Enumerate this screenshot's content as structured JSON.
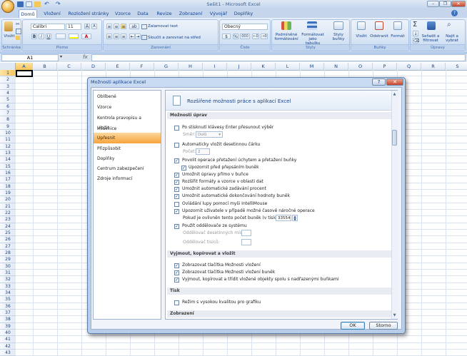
{
  "window": {
    "title": "Sešit1 - Microsoft Excel",
    "minimize": "–",
    "restore": "❐",
    "close": "✕"
  },
  "ribbon": {
    "tabs": [
      "Domů",
      "Vložení",
      "Rozložení stránky",
      "Vzorce",
      "Data",
      "Revize",
      "Zobrazení",
      "Vývojář",
      "Doplňky"
    ],
    "clipboard": {
      "paste": "Vložit",
      "label": "Schránka"
    },
    "font": {
      "name": "Calibri",
      "size": "11",
      "grow": "A",
      "shrink": "A",
      "bold": "B",
      "italic": "I",
      "underline": "U",
      "label": "Písmo"
    },
    "alignment": {
      "wrap": "Zalamovat text",
      "merge": "Sloučit a zarovnat na střed",
      "label": "Zarovnání"
    },
    "number": {
      "format": "Obecný",
      "currency": "%",
      "thousands": "000",
      "label": "Číslo"
    },
    "styles": {
      "conditional": "Podmíněné formátování",
      "table": "Formátovat jako tabulku",
      "cell_styles": "Styly buňky",
      "label": "Styly"
    },
    "cells": {
      "insert": "Vložit",
      "delete": "Odstranit",
      "format": "Formát",
      "label": "Buňky"
    },
    "editing": {
      "sum": "Σ",
      "sort": "Seřadit a filtrovat",
      "find": "Najít a vybrat",
      "label": "Úpravy"
    }
  },
  "formula_bar": {
    "name_box": "A1",
    "fx": "fx",
    "value": ""
  },
  "sheet": {
    "columns": [
      "A",
      "B",
      "C",
      "D",
      "E",
      "F",
      "G",
      "H",
      "I",
      "J",
      "K",
      "L",
      "M",
      "N",
      "O",
      "P",
      "Q",
      "R",
      "S"
    ],
    "rows": [
      "1",
      "2",
      "3",
      "4",
      "5",
      "6",
      "7",
      "8",
      "9",
      "10",
      "11",
      "12",
      "13",
      "14",
      "15",
      "16",
      "17",
      "18",
      "19",
      "20",
      "21",
      "22",
      "23",
      "24",
      "25",
      "26",
      "27",
      "28",
      "29",
      "30",
      "31",
      "32",
      "33",
      "34",
      "35",
      "36",
      "37",
      "38",
      "39",
      "40",
      "41",
      "42",
      "43"
    ]
  },
  "dialog": {
    "title": "Možnosti aplikace Excel",
    "help": "?",
    "close": "✕",
    "nav": [
      "Oblíbené",
      "Vzorce",
      "Kontrola pravopisu a mluvnice",
      "Uložit",
      "Upřesnit",
      "Přizpůsobit",
      "Doplňky",
      "Centrum zabezpečení",
      "Zdroje informací"
    ],
    "active_nav": "Upřesnit",
    "heading": "Rozšířené možnosti práce s aplikací Excel",
    "sections": {
      "editing": "Možnosti úprav",
      "cut_copy": "Vyjmout, kopírovat a vložit",
      "print": "Tisk",
      "display": "Zobrazení"
    },
    "options": {
      "move_after_enter": "Po stisknutí klávesy Enter přesunout výběr",
      "direction_label": "Směr:",
      "direction_value": "Dolů",
      "auto_decimal": "Automaticky vložit desetinnou čárku",
      "places_label": "Počet:",
      "places_value": "2",
      "fill_handle": "Povolit operace přetažení úchytem a přetažení buňky",
      "alert_overwrite": "Upozornit před přepsáním buněk",
      "edit_in_cell": "Umožnit úpravy přímo v buňce",
      "extend_formats": "Rozšířit formáty a vzorce v oblasti dat",
      "auto_percent": "Umožnit automatické zadávání procent",
      "autocomplete": "Umožnit automatické dokončování hodnoty buněk",
      "zoom_intellimouse": "Ovládání lupy pomocí myši IntelliMouse",
      "alert_time": "Upozornit uživatele v případě možné časově náročné operace",
      "cells_label": "Pokud je ovlivněn tento počet buněk (v tisících):",
      "cells_value": "33554",
      "system_separators": "Použít oddělovače ze systému",
      "decimal_sep": "Oddělovač desetinných míst:",
      "thousands_sep": "Oddělovač tisíců:",
      "paste_options": "Zobrazovat tlačítka Možnosti vložení",
      "insert_options": "Zobrazovat tlačítka Možnosti vložení buněk",
      "cut_sort_objects": "Vyjmout, kopírovat a třídit vložené objekty spolu s nadřazenými buňkami",
      "high_quality": "Režim s vysokou kvalitou pro grafiku"
    },
    "checked": {
      "move_after_enter": false,
      "auto_decimal": false,
      "fill_handle": true,
      "alert_overwrite": true,
      "edit_in_cell": true,
      "extend_formats": true,
      "auto_percent": true,
      "autocomplete": true,
      "zoom_intellimouse": false,
      "alert_time": true,
      "system_separators": true,
      "paste_options": true,
      "insert_options": true,
      "cut_sort_objects": true,
      "high_quality": false
    },
    "ok": "OK",
    "cancel": "Storno"
  },
  "icons": {
    "check": "✓",
    "dropdown": "▾",
    "scroll_up": "▲",
    "scroll_down": "▼"
  }
}
